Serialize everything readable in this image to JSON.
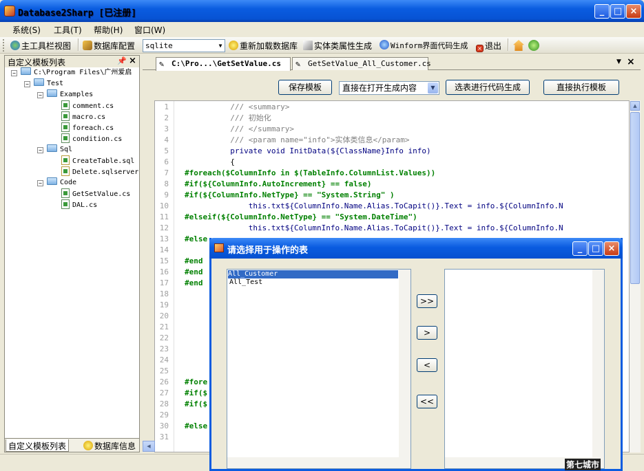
{
  "window": {
    "title": "Database2Sharp [已注册]"
  },
  "menu": [
    "系统(S)",
    "工具(T)",
    "帮助(H)",
    "窗口(W)"
  ],
  "toolbar": {
    "main_view": "主工具栏视图",
    "db_config": "数据库配置",
    "db_select": "sqlite",
    "reload": "重新加载数据库",
    "entity_gen": "实体类属性生成",
    "winform_gen": "Winform界面代码生成",
    "exit": "退出"
  },
  "left_panel": {
    "title": "自定义模板列表",
    "tree": {
      "root": "C:\\Program Files\\广州爱启",
      "test": "Test",
      "examples": "Examples",
      "examples_files": [
        "comment.cs",
        "macro.cs",
        "foreach.cs",
        "condition.cs"
      ],
      "sql": "Sql",
      "sql_files": [
        "CreateTable.sql",
        "Delete.sqlserver"
      ],
      "code": "Code",
      "code_files": [
        "GetSetValue.cs",
        "DAL.cs"
      ]
    },
    "tabs": [
      "自定义模板列表",
      "数据库信息"
    ]
  },
  "doc_tabs": [
    "C:\\Pro...\\GetSetValue.cs",
    "GetSetValue_All_Customer.cs"
  ],
  "editor_toolbar": {
    "save": "保存模板",
    "mode": "直接在打开生成内容",
    "select_table": "选表进行代码生成",
    "run": "直接执行模板"
  },
  "code_lines": [
    {
      "n": "1",
      "t": "          /// <summary>"
    },
    {
      "n": "2",
      "t": "          /// 初始化"
    },
    {
      "n": "3",
      "t": "          /// </summary>"
    },
    {
      "n": "4",
      "t": "          /// <param name=\"info\">实体类信息</param>"
    },
    {
      "n": "5",
      "t": "          private void InitData(${ClassName}Info info)"
    },
    {
      "n": "6",
      "t": "          {"
    },
    {
      "n": "7",
      "t": "#foreach($ColumnInfo in $(TableInfo.ColumnList.Values))"
    },
    {
      "n": "8",
      "t": "#if(${ColumnInfo.AutoIncrement} == false)"
    },
    {
      "n": "9",
      "t": "#if(${ColumnInfo.NetType} == \"System.String\" )"
    },
    {
      "n": "10",
      "t": "              this.txt${ColumnInfo.Name.Alias.ToCapit()}.Text = info.${ColumnInfo.N"
    },
    {
      "n": "11",
      "t": "#elseif(${ColumnInfo.NetType} == \"System.DateTime\")"
    },
    {
      "n": "12",
      "t": "              this.txt${ColumnInfo.Name.Alias.ToCapit()}.Text = info.${ColumnInfo.N"
    },
    {
      "n": "13",
      "t": "#else"
    },
    {
      "n": "14",
      "t": ""
    },
    {
      "n": "15",
      "t": "#end"
    },
    {
      "n": "16",
      "t": "#end"
    },
    {
      "n": "17",
      "t": "#end"
    },
    {
      "n": "18",
      "t": ""
    },
    {
      "n": "19",
      "t": ""
    },
    {
      "n": "20",
      "t": ""
    },
    {
      "n": "21",
      "t": ""
    },
    {
      "n": "22",
      "t": ""
    },
    {
      "n": "23",
      "t": ""
    },
    {
      "n": "24",
      "t": ""
    },
    {
      "n": "25",
      "t": ""
    },
    {
      "n": "26",
      "t": "#fore"
    },
    {
      "n": "27",
      "t": "#if($"
    },
    {
      "n": "28",
      "t": "#if($"
    },
    {
      "n": "29",
      "t": ""
    },
    {
      "n": "30",
      "t": "#else"
    },
    {
      "n": "31",
      "t": ""
    }
  ],
  "dialog": {
    "title": "请选择用于操作的表",
    "left_items": [
      "All_Customer",
      "All_Test"
    ],
    "move_buttons": [
      ">>",
      ">",
      "<",
      "<<"
    ]
  },
  "watermark": "第七城市"
}
